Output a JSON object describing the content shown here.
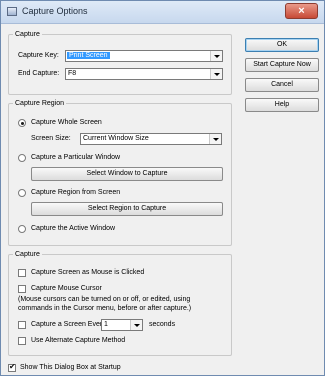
{
  "window": {
    "title": "Capture Options",
    "close_glyph": "×"
  },
  "capture_keys": {
    "legend": "Capture",
    "capture_key_label": "Capture Key:",
    "capture_key_value": "Print Screen",
    "end_capture_label": "End Capture:",
    "end_capture_value": "F8"
  },
  "side_buttons": {
    "ok": "OK",
    "start_capture_now": "Start Capture Now",
    "cancel": "Cancel",
    "help": "Help"
  },
  "region": {
    "legend": "Capture Region",
    "whole_screen": "Capture Whole Screen",
    "screen_size_label": "Screen Size:",
    "screen_size_value": "Current Window Size",
    "particular_window": "Capture a Particular Window",
    "select_window_button": "Select Window to Capture",
    "region_from_screen": "Capture Region from Screen",
    "select_region_button": "Select Region to Capture",
    "active_window": "Capture the Active Window",
    "selected": "whole_screen"
  },
  "capture_opts": {
    "legend": "Capture",
    "as_mouse_clicked": "Capture Screen as Mouse is Clicked",
    "mouse_cursor": "Capture Mouse Cursor",
    "note_line1": "(Mouse cursors can be turned on or off, or edited, using",
    "note_line2": "commands in the Cursor menu, before or after capture.)",
    "every_label": "Capture a Screen Every",
    "every_value": "1",
    "seconds_label": "seconds",
    "alternate_method": "Use Alternate Capture Method"
  },
  "startup": {
    "label": "Show This Dialog Box at Startup",
    "checked": true
  },
  "colors": {
    "highlight": "#3399ff",
    "title_bg": "#c7d8ee",
    "close_bg": "#c74a36"
  }
}
